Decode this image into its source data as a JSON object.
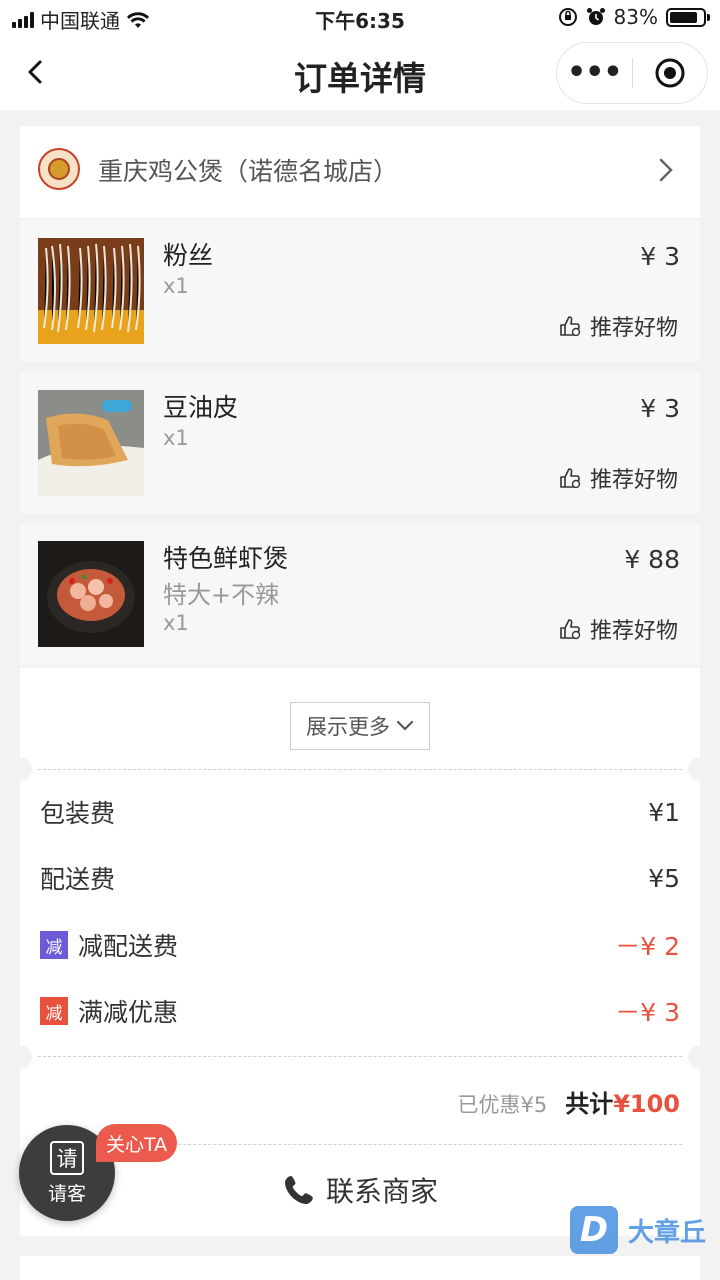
{
  "status": {
    "carrier": "中国联通",
    "time": "下午6:35",
    "battery": "83%",
    "battery_level": 0.83
  },
  "nav": {
    "title": "订单详情"
  },
  "shop": {
    "name": "重庆鸡公煲（诺德名城店）"
  },
  "items": [
    {
      "name": "粉丝",
      "spec": "",
      "qty": "x1",
      "price": "¥ 3",
      "recommend": "推荐好物"
    },
    {
      "name": "豆油皮",
      "spec": "",
      "qty": "x1",
      "price": "¥ 3",
      "recommend": "推荐好物"
    },
    {
      "name": "特色鲜虾煲",
      "spec": "特大+不辣",
      "qty": "x1",
      "price": "¥ 88",
      "recommend": "推荐好物"
    }
  ],
  "show_more": "展示更多",
  "fees": [
    {
      "label": "包装费",
      "value": "¥1",
      "tag": "",
      "tag_color": ""
    },
    {
      "label": "配送费",
      "value": "¥5",
      "tag": "",
      "tag_color": ""
    },
    {
      "label": "减配送费",
      "value": "－¥ 2",
      "tag": "减",
      "tag_color": "#6b5bd6"
    },
    {
      "label": "满减优惠",
      "value": "－¥ 3",
      "tag": "减",
      "tag_color": "#e8513d"
    }
  ],
  "summary": {
    "saved": "已优惠¥5",
    "total_label": "共计",
    "total_amount": "¥100"
  },
  "contact": {
    "label": "联系商家"
  },
  "treat": {
    "icon_char": "请",
    "label": "请客",
    "badge": "关心TA"
  },
  "watermark": {
    "logo": "D",
    "text": "大章丘"
  }
}
